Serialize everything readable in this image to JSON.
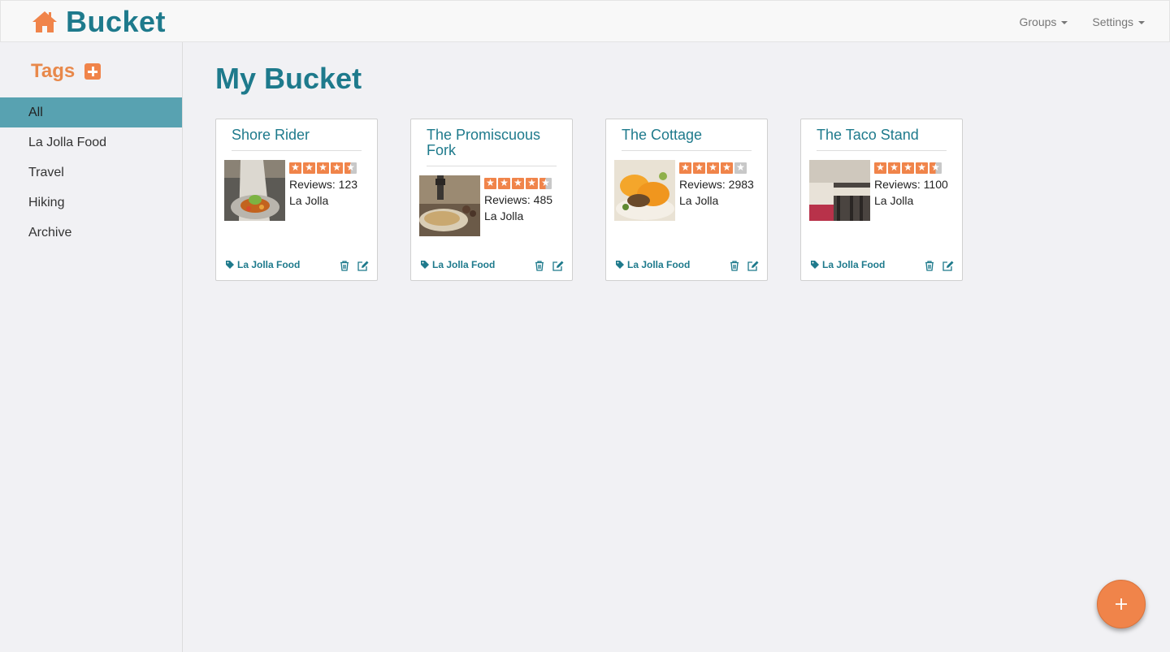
{
  "navbar": {
    "brand": "Bucket",
    "brand_icon": "home-icon",
    "menus": [
      "Groups",
      "Settings"
    ]
  },
  "colors": {
    "primary": "#1e7a8c",
    "accent": "#f0844a",
    "active_tag": "#58a2b1"
  },
  "sidebar": {
    "title": "Tags",
    "add_icon": "plus-square-icon",
    "items": [
      {
        "label": "All",
        "active": true
      },
      {
        "label": "La Jolla Food",
        "active": false
      },
      {
        "label": "Travel",
        "active": false
      },
      {
        "label": "Hiking",
        "active": false
      },
      {
        "label": "Archive",
        "active": false
      }
    ]
  },
  "main": {
    "title": "My Bucket",
    "cards": [
      {
        "title": "Shore Rider",
        "rating": 4.5,
        "reviews": "Reviews: 123",
        "location": "La Jolla",
        "tag": "La Jolla Food"
      },
      {
        "title": "The Promiscuous Fork",
        "rating": 4.5,
        "reviews": "Reviews: 485",
        "location": "La Jolla",
        "tag": "La Jolla Food"
      },
      {
        "title": "The Cottage",
        "rating": 4,
        "reviews": "Reviews: 2983",
        "location": "La Jolla",
        "tag": "La Jolla Food"
      },
      {
        "title": "The Taco Stand",
        "rating": 4.5,
        "reviews": "Reviews: 1100",
        "location": "La Jolla",
        "tag": "La Jolla Food"
      }
    ]
  },
  "fab": {
    "icon": "plus-icon"
  }
}
